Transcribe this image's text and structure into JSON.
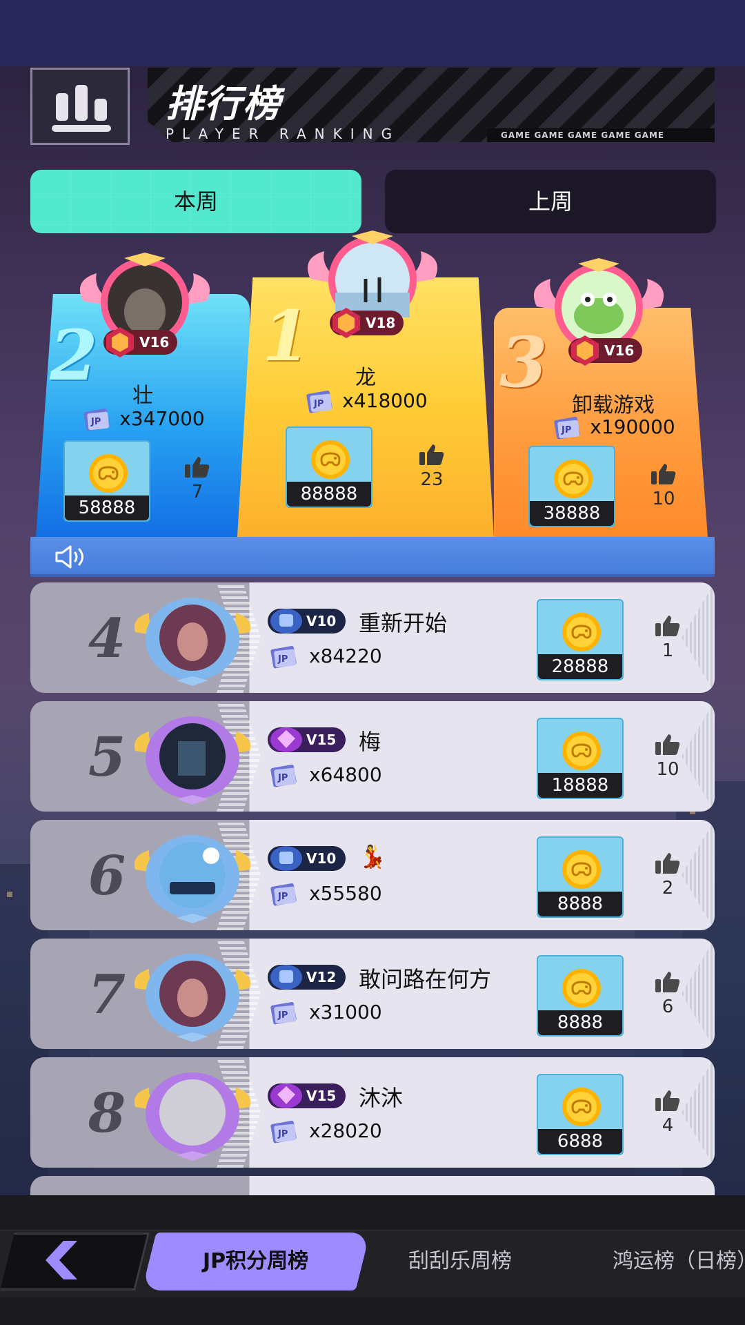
{
  "header": {
    "title": "排行榜",
    "subtitle": "PLAYER RANKING",
    "game_strip": "GAME  GAME  GAME  GAME  GAME"
  },
  "tabs": {
    "this_week": "本周",
    "last_week": "上周"
  },
  "podium": [
    {
      "rank": "1",
      "name": "龙",
      "vip": "V18",
      "score": "x418000",
      "coins": "88888",
      "likes": "23"
    },
    {
      "rank": "2",
      "name": "壮",
      "vip": "V16",
      "score": "x347000",
      "coins": "58888",
      "likes": "7"
    },
    {
      "rank": "3",
      "name": "卸载游戏",
      "vip": "V16",
      "score": "x190000",
      "coins": "38888",
      "likes": "10"
    }
  ],
  "list": [
    {
      "rank": "4",
      "vip": "V10",
      "name": "重新开始",
      "score": "x84220",
      "coins": "28888",
      "likes": "1"
    },
    {
      "rank": "5",
      "vip": "V15",
      "name": "梅",
      "score": "x64800",
      "coins": "18888",
      "likes": "10"
    },
    {
      "rank": "6",
      "vip": "V10",
      "name": "💃",
      "score": "x55580",
      "coins": "8888",
      "likes": "2"
    },
    {
      "rank": "7",
      "vip": "V12",
      "name": "敢问路在何方",
      "score": "x31000",
      "coins": "8888",
      "likes": "6"
    },
    {
      "rank": "8",
      "vip": "V15",
      "name": "沐沐",
      "score": "x28020",
      "coins": "6888",
      "likes": "4"
    }
  ],
  "bottom_tabs": [
    "JP积分周榜",
    "刮刮乐周榜",
    "鸿运榜（日榜）"
  ],
  "icons": {
    "header": "bar-chart-icon",
    "announce": "speaker-icon",
    "like": "thumbs-up-icon",
    "coin": "gamepad-coin-icon",
    "jackpot": "jp-jackpot-icon",
    "back": "chevron-left-icon"
  },
  "colors": {
    "tab_active": "#52e9cf",
    "podium_gold": "#ffcc37",
    "podium_blue": "#28a2f2",
    "podium_orange": "#ff9f41",
    "bottom_tab_active": "#9d8bff"
  }
}
